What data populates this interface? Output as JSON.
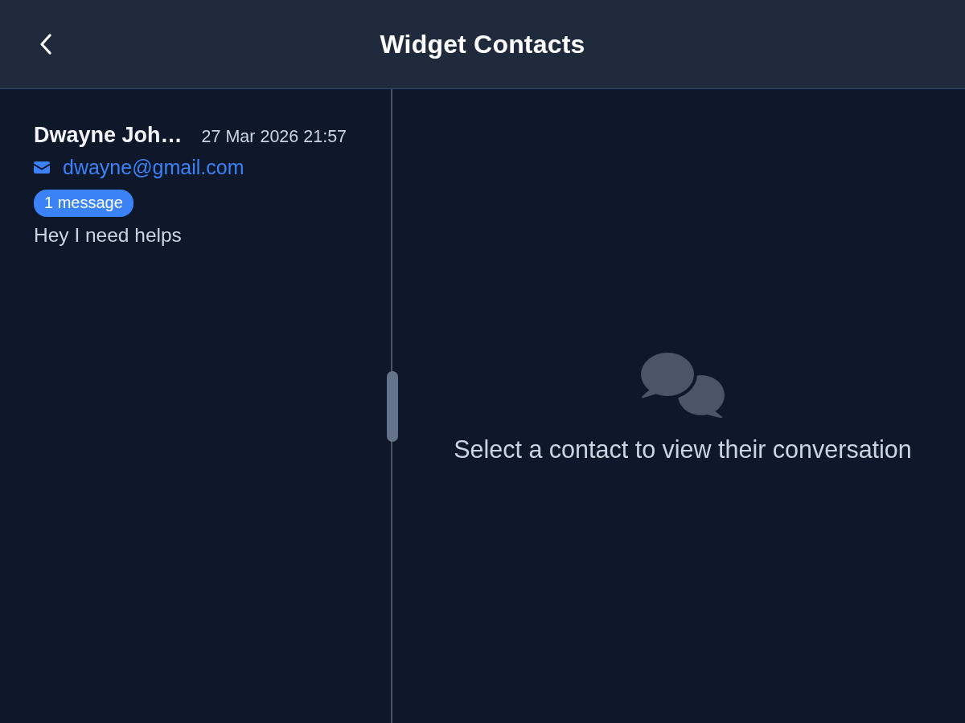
{
  "header": {
    "title": "Widget Contacts"
  },
  "contacts": [
    {
      "name": "Dwayne Joh…",
      "time": "27 Mar 2026 21:57",
      "email": "dwayne@gmail.com",
      "badge": "1 message",
      "preview": "Hey I need helps",
      "selected": false
    }
  ],
  "empty_state": {
    "message": "Select a contact to view their conversation"
  }
}
